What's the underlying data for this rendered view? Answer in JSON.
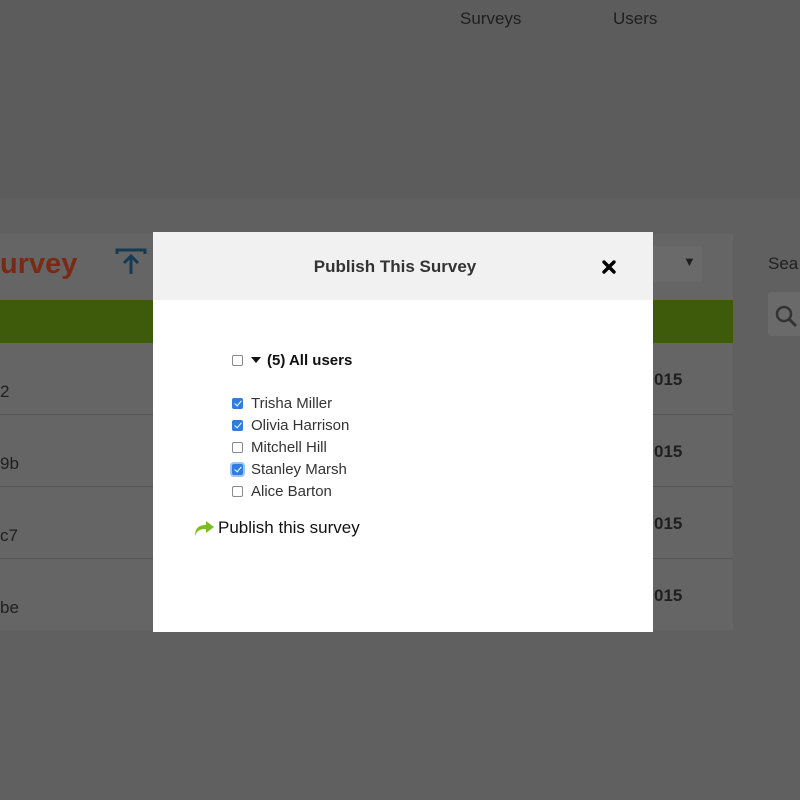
{
  "nav": {
    "items": [
      "Surveys",
      "Users"
    ]
  },
  "background": {
    "panel_title": "urvey",
    "search_label": "Sea",
    "rows": [
      {
        "left": "2",
        "right": "015"
      },
      {
        "left": "9b",
        "right": "015"
      },
      {
        "left": "c7",
        "right": "015"
      },
      {
        "left": "be",
        "right": "015"
      }
    ]
  },
  "modal": {
    "title": "Publish This Survey",
    "all_users": {
      "label": "(5) All users",
      "checked": false
    },
    "users": [
      {
        "name": "Trisha Miller",
        "checked": true
      },
      {
        "name": "Olivia Harrison",
        "checked": true
      },
      {
        "name": "Mitchell Hill",
        "checked": false
      },
      {
        "name": "Stanley Marsh",
        "checked": true,
        "focused": true
      },
      {
        "name": "Alice Barton",
        "checked": false
      }
    ],
    "publish_label": "Publish this survey"
  },
  "colors": {
    "overlay": "#5e5e5e",
    "modal_header": "#f1f1f1",
    "checkbox_checked": "#2f7de1",
    "publish_icon": "#7bbf1e",
    "brand_title": "#7a2a14"
  },
  "icons": {
    "close": "close-icon",
    "share": "share-arrow-icon",
    "upload": "upload-icon",
    "search": "search-icon",
    "caret": "caret-down-icon"
  }
}
